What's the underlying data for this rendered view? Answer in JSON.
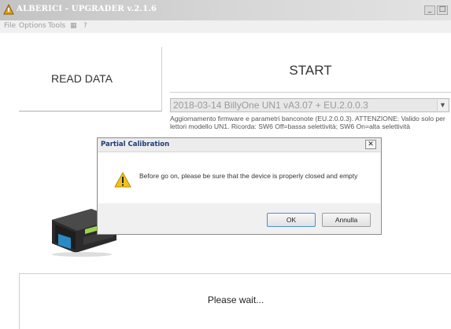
{
  "window": {
    "title": "ALBERICI - UPGRADER v.2.1.6",
    "minimize_label": "_",
    "maximize_label": "□"
  },
  "menu": {
    "items": [
      "File",
      "Options",
      "Tools",
      "▦",
      "?"
    ]
  },
  "main": {
    "read_data_label": "READ DATA",
    "start_label": "START",
    "firmware_select_value": "2018-03-14 BillyOne UN1 vA3.07 + EU.2.0.0.3",
    "description": "Aggiornamento firmware e parametri banconote (EU.2.0.0.3). ATTENZIONE: Valido solo per lettori modello UN1. Ricorda: SW6 Off=bassa selettività; SW6 On=alta selettività"
  },
  "dialog": {
    "title": "Partial Calibration",
    "close_label": "✕",
    "icon": "warning-icon",
    "message": "Before go on, please be sure that the device is properly closed and empty",
    "ok_label": "OK",
    "cancel_label": "Annulla"
  },
  "status": {
    "text": "Please wait..."
  },
  "colors": {
    "dialog_title_text": "#1f3a78",
    "warning_yellow": "#f2c21a"
  }
}
